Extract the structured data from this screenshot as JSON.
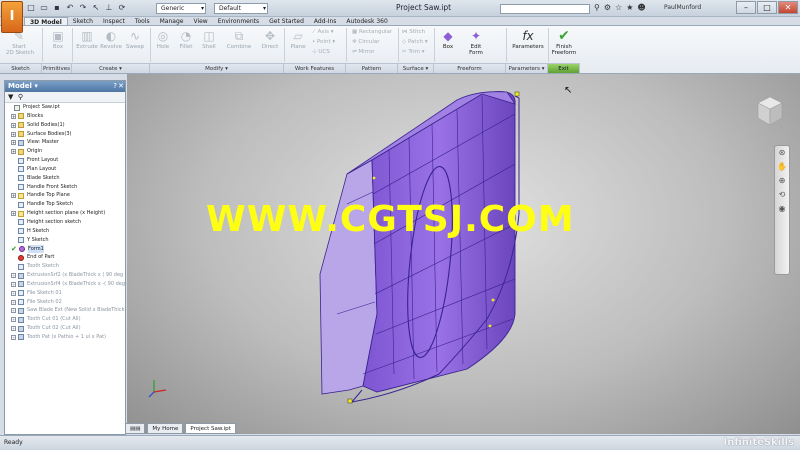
{
  "app": {
    "logo_letter": "I",
    "window_title": "Project Saw.ipt",
    "material_combo": "Generic",
    "appearance_combo": "Default",
    "user": "PaulMunford",
    "quick_access_icons": [
      "new-icon",
      "open-icon",
      "save-icon",
      "undo-icon",
      "redo-icon",
      "select-icon",
      "measure-icon",
      "update-icon"
    ]
  },
  "tabs": [
    "3D Model",
    "Sketch",
    "Inspect",
    "Tools",
    "Manage",
    "View",
    "Environments",
    "Get Started",
    "Add-Ins",
    "Autodesk 360"
  ],
  "ribbon": {
    "start_sketch": "Start\n2D Sketch",
    "box_prim": "Box",
    "extrude": "Extrude",
    "revolve": "Revolve",
    "sweep": "Sweep",
    "hole": "Hole",
    "fillet": "Fillet",
    "shell": "Shell",
    "combine": "Combine",
    "direct": "Direct",
    "plane": "Plane",
    "axis": "Axis",
    "point": "Point",
    "ucs": "UCS",
    "rectangular": "Rectangular",
    "circular": "Circular",
    "mirror": "Mirror",
    "stitch": "Stitch",
    "patch": "Patch",
    "trim": "Trim",
    "box_freeform": "Box",
    "edit_form": "Edit\nForm",
    "parameters": "Parameters",
    "finish_freeform": "Finish\nFreeform",
    "groups": {
      "sketch": "Sketch",
      "primitives": "Primitives",
      "create": "Create ▾",
      "modify": "Modify ▾",
      "work_features": "Work Features",
      "pattern": "Pattern",
      "surface": "Surface ▾",
      "freeform": "Freeform",
      "parameters": "Parameters ▾",
      "exit": "Exit"
    }
  },
  "browser": {
    "title": "Model ▾",
    "items": [
      {
        "label": "Project Saw.ipt",
        "indent": 0,
        "icon": "part",
        "expand": ""
      },
      {
        "label": "Blocks",
        "indent": 1,
        "icon": "fold",
        "expand": "+"
      },
      {
        "label": "Solid Bodies(1)",
        "indent": 1,
        "icon": "fold",
        "expand": "+"
      },
      {
        "label": "Surface Bodies(3)",
        "indent": 1,
        "icon": "fold",
        "expand": "+"
      },
      {
        "label": "View: Master",
        "indent": 1,
        "icon": "ft",
        "expand": "+"
      },
      {
        "label": "Origin",
        "indent": 1,
        "icon": "fold",
        "expand": "+"
      },
      {
        "label": "Front Layout",
        "indent": 1,
        "icon": "sk",
        "expand": ""
      },
      {
        "label": "Plan Layout",
        "indent": 1,
        "icon": "sk",
        "expand": ""
      },
      {
        "label": "Blade Sketch",
        "indent": 1,
        "icon": "sk",
        "expand": ""
      },
      {
        "label": "Handle Front Sketch",
        "indent": 1,
        "icon": "sk",
        "expand": ""
      },
      {
        "label": "Handle Top Plane",
        "indent": 1,
        "icon": "pl",
        "expand": "+"
      },
      {
        "label": "Handle Top Sketch",
        "indent": 1,
        "icon": "sk",
        "expand": ""
      },
      {
        "label": "Height section plane (x Height)",
        "indent": 1,
        "icon": "pl",
        "expand": "+"
      },
      {
        "label": "Height section sketch",
        "indent": 1,
        "icon": "sk",
        "expand": ""
      },
      {
        "label": "H Sketch",
        "indent": 1,
        "icon": "sk",
        "expand": ""
      },
      {
        "label": "Y Sketch",
        "indent": 1,
        "icon": "sk",
        "expand": ""
      },
      {
        "label": "Form1",
        "indent": 1,
        "icon": "form",
        "expand": "",
        "check": true,
        "selected": true
      },
      {
        "label": "End of Part",
        "indent": 1,
        "icon": "end",
        "expand": ""
      },
      {
        "label": "Tooth Sketch",
        "indent": 1,
        "icon": "sk",
        "expand": "",
        "dim": true
      },
      {
        "label": "ExtrusionSrf2 (x BladeThick x ( 90 deg -",
        "indent": 1,
        "icon": "ft",
        "expand": "+",
        "dim": true
      },
      {
        "label": "ExtrusionSrf4 (x BladeThick x -( 90 deg -",
        "indent": 1,
        "icon": "ft",
        "expand": "+",
        "dim": true
      },
      {
        "label": "File Sketch 01",
        "indent": 1,
        "icon": "sk",
        "expand": "+",
        "dim": true
      },
      {
        "label": "File Sketch 02",
        "indent": 1,
        "icon": "sk",
        "expand": "+",
        "dim": true
      },
      {
        "label": "Saw Blade Ext (New Solid x BladeThick)",
        "indent": 1,
        "icon": "ft",
        "expand": "+",
        "dim": true
      },
      {
        "label": "Tooth Cut 01 (Cut All)",
        "indent": 1,
        "icon": "ft",
        "expand": "+",
        "dim": true
      },
      {
        "label": "Tooth Cut 02 (Cut All)",
        "indent": 1,
        "icon": "ft",
        "expand": "+",
        "dim": true
      },
      {
        "label": "Tooth Pat (x Pathio + 1 ul x Pat)",
        "indent": 1,
        "icon": "ft",
        "expand": "+",
        "dim": true
      }
    ]
  },
  "doc_tabs": {
    "home": "My Home",
    "active": "Project Saw.ipt"
  },
  "watermark": "WWW.CGTSJ.COM",
  "status": {
    "text": "Ready",
    "logo": "InfiniteSkills"
  },
  "colors": {
    "form": "#8a5fd6",
    "form_edge": "#3a2390",
    "watermark": "#ffff14",
    "accent": "#4f75a3"
  }
}
